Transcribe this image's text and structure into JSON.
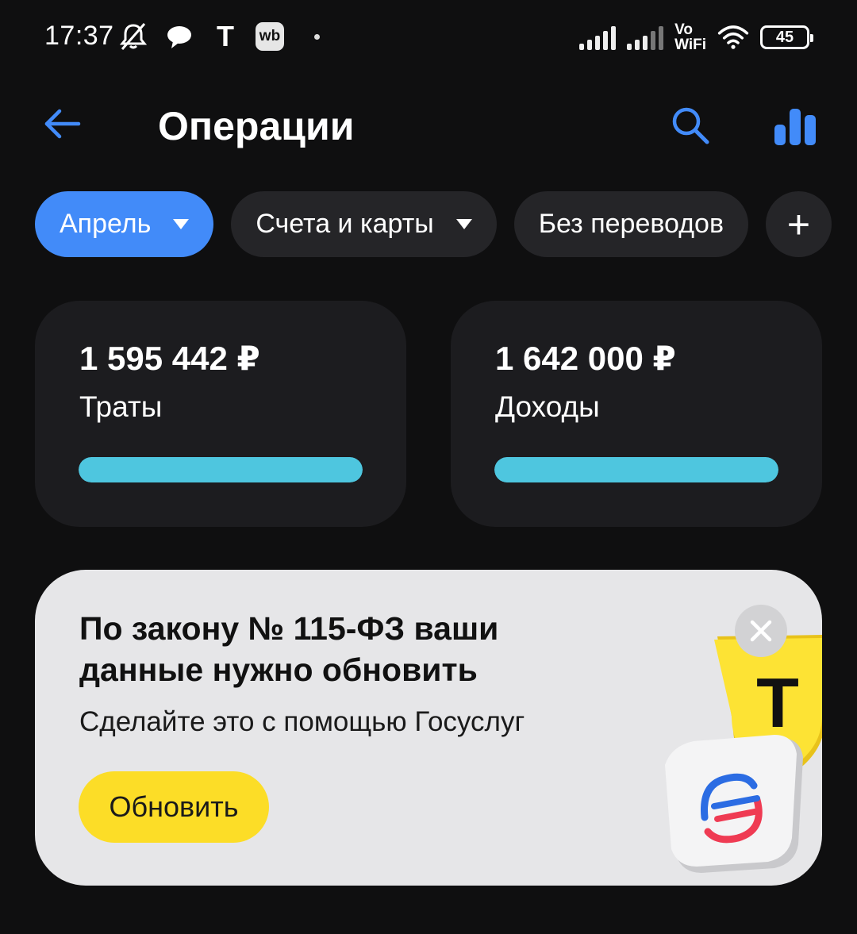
{
  "status_bar": {
    "time": "17:37",
    "icons": [
      "mute-icon",
      "chat-icon",
      "t-app-icon",
      "wb-app-icon",
      "notification-dot-icon",
      "signal-sim1-icon",
      "signal-sim2-icon",
      "vowifi-icon",
      "wifi-icon",
      "battery-icon"
    ],
    "t_letter": "T",
    "wb_label": "wb",
    "vowifi_line1": "Vo",
    "vowifi_line2": "WiFi",
    "battery_percent": "45"
  },
  "header": {
    "title": "Операции",
    "back_icon": "arrow-left-icon",
    "search_icon": "search-icon",
    "stats_icon": "bar-chart-icon"
  },
  "filters": {
    "month": "Апрель",
    "accounts": "Счета и карты",
    "transfers": "Без переводов",
    "add": "+"
  },
  "summary": {
    "spending": {
      "amount": "1 595 442 ₽",
      "label": "Траты",
      "bar_fraction": 1.0
    },
    "income": {
      "amount": "1 642 000 ₽",
      "label": "Доходы",
      "bar_fraction": 1.0
    }
  },
  "banner": {
    "title": "По закону № 115-ФЗ ваши данные нужно обновить",
    "subtitle": "Сделайте это с помощью Госуслуг",
    "button": "Обновить",
    "close_icon": "close-icon",
    "shield_letter": "Т"
  },
  "colors": {
    "background": "#0f0f10",
    "accent_blue": "#428bf9",
    "chip_bg": "#252528",
    "card_bg": "#1c1c1f",
    "bar_cyan": "#4ec6df",
    "banner_bg": "#e6e6e8",
    "button_yellow": "#fcdd27"
  }
}
